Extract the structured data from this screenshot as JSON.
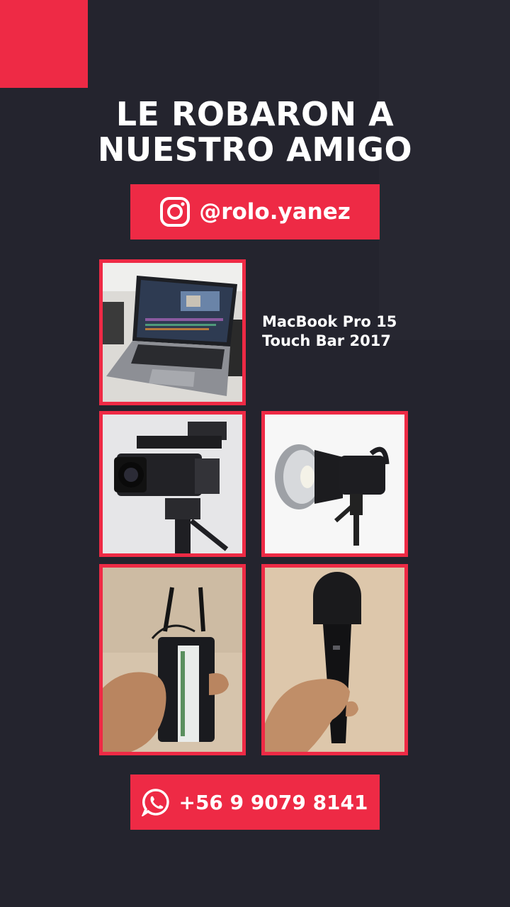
{
  "header": {
    "title_line1": "LE ROBARON A",
    "title_line2": "NUESTRO AMIGO"
  },
  "instagram": {
    "icon": "instagram-icon",
    "handle": "@rolo.yanez"
  },
  "items": {
    "laptop_label_line1": "MacBook Pro 15",
    "laptop_label_line2": "Touch Bar 2017",
    "photos": [
      "laptop-photo",
      "camcorder-photo",
      "studio-light-photo",
      "wireless-receiver-photo",
      "microphone-photo"
    ]
  },
  "contact": {
    "icon": "whatsapp-icon",
    "phone": "+56 9 9079 8141"
  },
  "colors": {
    "accent": "#ee2a45",
    "background": "#24242e",
    "text": "#ffffff"
  }
}
